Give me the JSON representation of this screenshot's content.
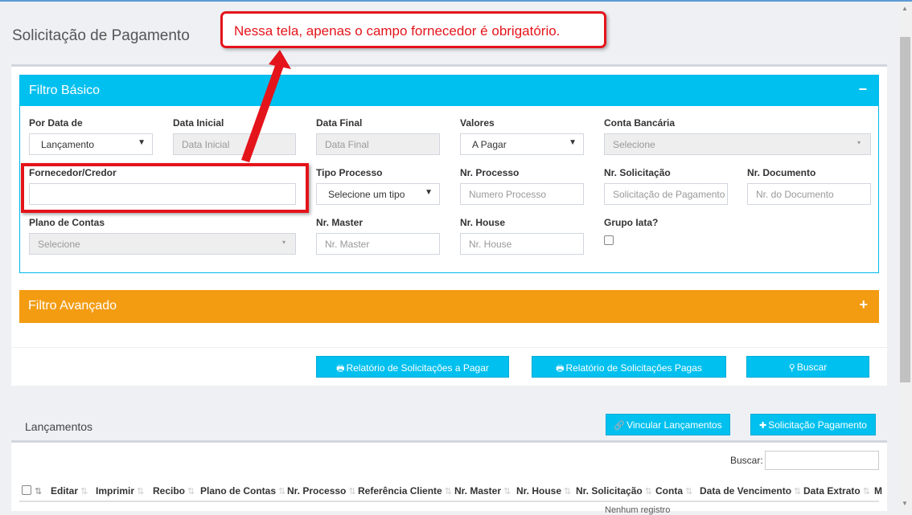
{
  "page": {
    "title": "Solicitação de Pagamento"
  },
  "annotation": {
    "callout": "Nessa tela, apenas o campo fornecedor é obrigatório."
  },
  "filtro_basico": {
    "title": "Filtro Básico",
    "toggle": "−",
    "por_data_de": {
      "label": "Por Data de",
      "value": "Lançamento"
    },
    "data_inicial": {
      "label": "Data Inicial",
      "placeholder": "Data Inicial"
    },
    "data_final": {
      "label": "Data Final",
      "placeholder": "Data Final"
    },
    "valores": {
      "label": "Valores",
      "value": "A Pagar"
    },
    "conta_bancaria": {
      "label": "Conta Bancária",
      "value": "Selecione"
    },
    "fornecedor": {
      "label": "Fornecedor/Credor",
      "value": ""
    },
    "tipo_processo": {
      "label": "Tipo Processo",
      "value": "Selecione um tipo"
    },
    "nr_processo": {
      "label": "Nr. Processo",
      "placeholder": "Numero Processo"
    },
    "nr_solicitacao": {
      "label": "Nr. Solicitação",
      "placeholder": "Solicitação de Pagamento"
    },
    "nr_documento": {
      "label": "Nr. Documento",
      "placeholder": "Nr. do Documento"
    },
    "plano_de_contas": {
      "label": "Plano de Contas",
      "value": "Selecione"
    },
    "nr_master": {
      "label": "Nr. Master",
      "placeholder": "Nr. Master"
    },
    "nr_house": {
      "label": "Nr. House",
      "placeholder": "Nr. House"
    },
    "grupo_iata": {
      "label": "Grupo Iata?",
      "checked": false
    }
  },
  "filtro_avancado": {
    "title": "Filtro Avançado",
    "toggle": "+"
  },
  "actions": {
    "relatorio_a_pagar": "Relatório de Solicitações a Pagar",
    "relatorio_pagas": "Relatório de Solicitações Pagas",
    "buscar": "Buscar"
  },
  "lancamentos": {
    "title": "Lançamentos",
    "vincular": "Vincular Lançamentos",
    "nova_solicitacao": "Solicitação Pagamento",
    "search_label": "Buscar:",
    "columns": [
      "Editar",
      "Imprimir",
      "Recibo",
      "Plano de Contas",
      "Nr. Processo",
      "Referência Cliente",
      "Nr. Master",
      "Nr. House",
      "Nr. Solicitação",
      "Conta",
      "Data de Vencimento",
      "Data Extrato",
      "M"
    ],
    "empty_cutoff": "Nenhum registro"
  },
  "icons": {
    "print": "print-icon",
    "search": "search-icon",
    "link": "link-icon",
    "plus": "plus-icon",
    "sort": "sort-icon"
  },
  "colors": {
    "info": "#00c0ef",
    "warning": "#f39c12",
    "annotation": "#e4141b"
  }
}
